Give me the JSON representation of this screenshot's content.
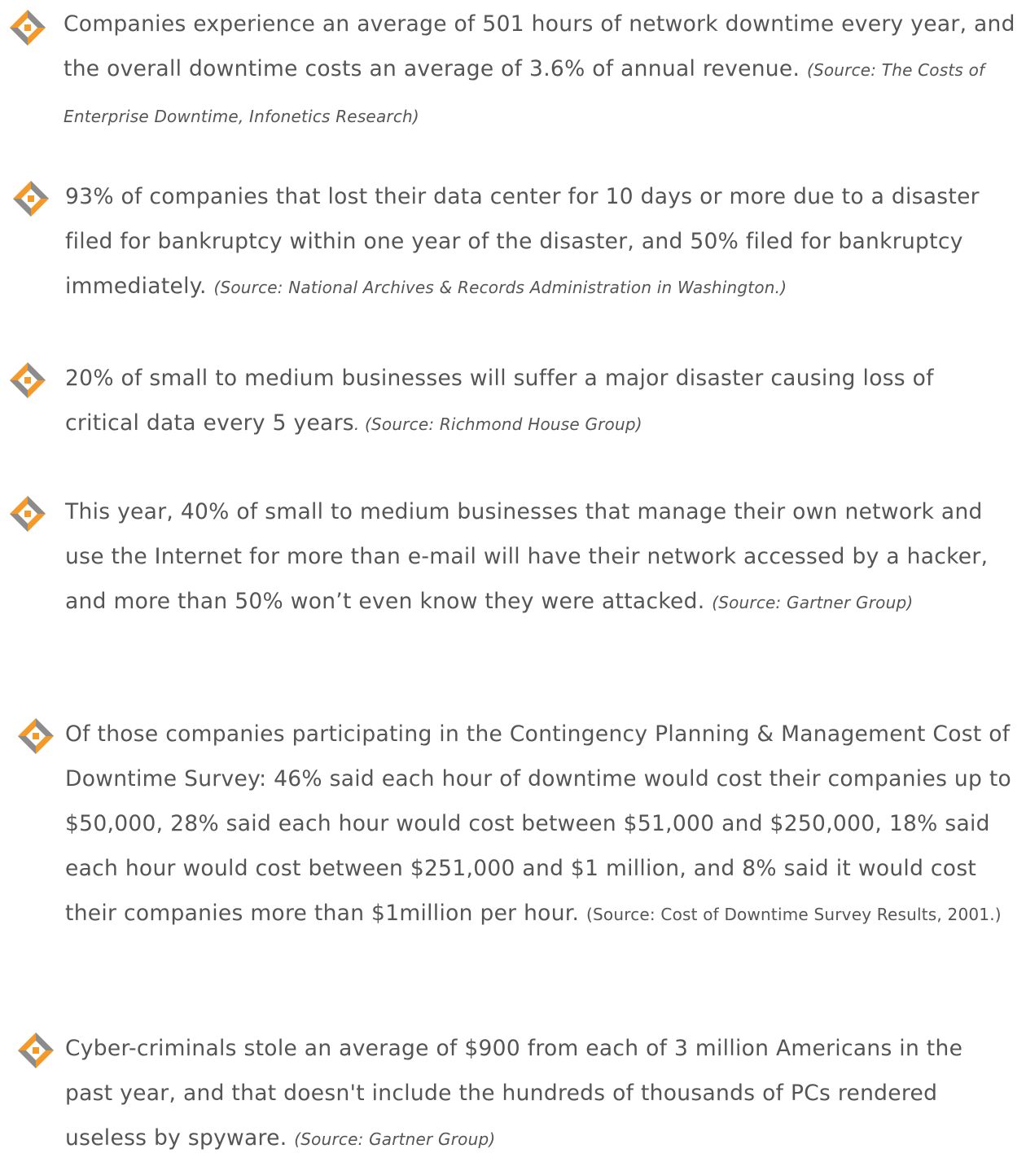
{
  "accent_colors": {
    "bullet_orange": "#F39A2B",
    "bullet_grey": "#8C8C8C",
    "text": "#555555"
  },
  "bullet_icon_name": "puzzle-arrows-icon",
  "stats": [
    {
      "text": "Companies experience an average of 501 hours of network downtime every year, and the overall downtime costs an average of 3.6% of annual revenue. ",
      "source": "(Source: The Costs of Enterprise Downtime, Infonetics Research)"
    },
    {
      "text": "93% of companies that lost their data center for 10 days or more due to a disaster filed for bankruptcy within one year of the disaster, and 50% filed for bankruptcy immediately. ",
      "source": "(Source: National Archives & Records Administration in Washington.)"
    },
    {
      "text": "20% of small to medium businesses will suffer a major disaster causing loss of critical data every 5 years",
      "source": ". (Source: Richmond House Group)"
    },
    {
      "text": "This year, 40% of small to medium businesses that manage their own network and use the Internet for more than e-mail will have their network accessed by a hacker, and more than 50% won’t even know they were attacked. ",
      "source": "(Source: Gartner Group)"
    },
    {
      "text": "Of those companies participating in the Contingency Planning & Management Cost of Downtime Survey: 46% said each hour of downtime would cost their companies up to $50,000, 28% said each hour would cost between $51,000 and $250,000, 18% said each hour would cost between $251,000 and $1 million, and 8% said it would cost their companies more than $1million per hour. ",
      "source": "(Source: Cost of Downtime Survey Results, 2001.)"
    },
    {
      "text": "Cyber-criminals stole an average of $900 from each of 3 million Americans in the past year, and that doesn't include the hundreds of thousands of PCs rendered useless by spyware. ",
      "source": "(Source: Gartner Group)"
    }
  ]
}
